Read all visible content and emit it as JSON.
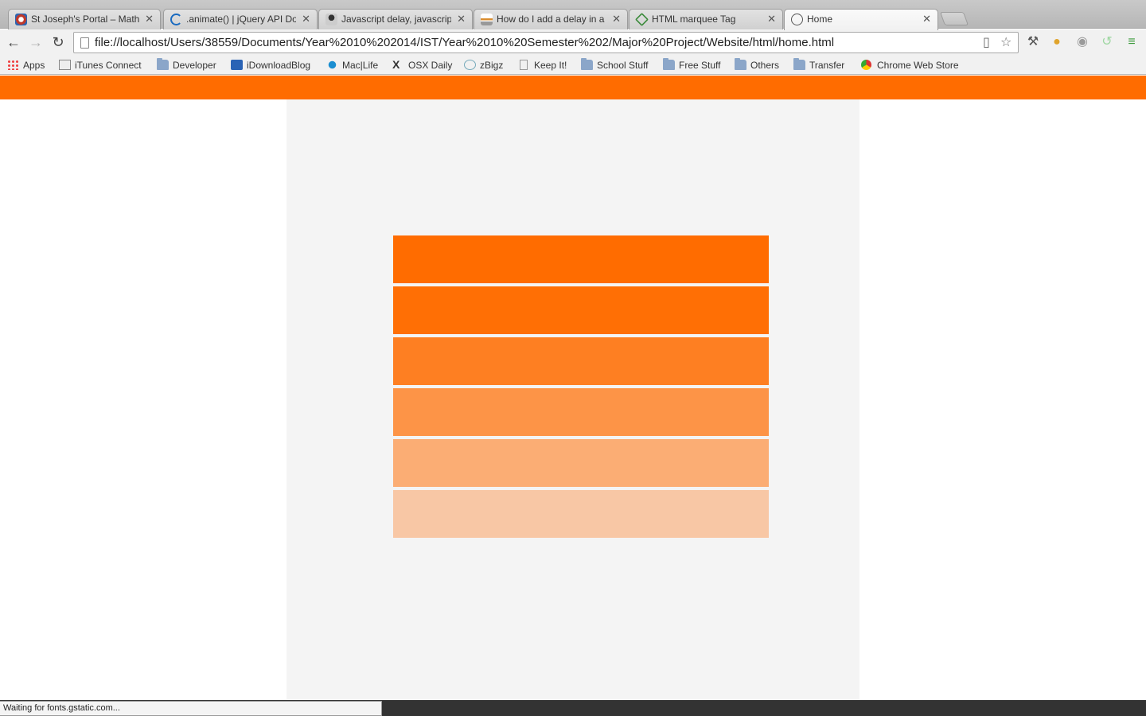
{
  "browser": {
    "tabs": [
      {
        "title": "St Joseph's Portal – Mathem",
        "icon": "portal-icon",
        "color": "#c0392b"
      },
      {
        "title": ".animate() | jQuery API Doc",
        "icon": "jquery-icon",
        "color": "#1a6bc0"
      },
      {
        "title": "Javascript delay, javascript",
        "icon": "avatar-icon",
        "color": "#555555"
      },
      {
        "title": "How do I add a delay in a Ja",
        "icon": "stackoverflow-icon",
        "color": "#d98b2b"
      },
      {
        "title": "HTML marquee Tag",
        "icon": "tutorialspoint-icon",
        "color": "#3a8a3a"
      },
      {
        "title": "Home",
        "icon": "page-loading-icon",
        "color": "#777777"
      }
    ],
    "address": "file://localhost/Users/38559/Documents/Year%2010%202014/IST/Year%2010%20Semester%202/Major%20Project/Website/html/home.html",
    "bookmarks": [
      {
        "label": "Apps",
        "icon": "apps-grid-icon"
      },
      {
        "label": "iTunes Connect",
        "icon": "itunes-connect-icon"
      },
      {
        "label": "Developer",
        "icon": "folder-icon"
      },
      {
        "label": "iDownloadBlog",
        "icon": "idb-icon"
      },
      {
        "label": "Mac|Life",
        "icon": "maclife-icon"
      },
      {
        "label": "OSX Daily",
        "icon": "osx-daily-icon"
      },
      {
        "label": "zBigz",
        "icon": "zbigz-icon"
      },
      {
        "label": "Keep It!",
        "icon": "page-icon"
      },
      {
        "label": "School Stuff",
        "icon": "folder-icon"
      },
      {
        "label": "Free Stuff",
        "icon": "folder-icon"
      },
      {
        "label": "Others",
        "icon": "folder-icon"
      },
      {
        "label": "Transfer",
        "icon": "folder-icon"
      },
      {
        "label": "Chrome Web Store",
        "icon": "chrome-web-store-icon"
      }
    ],
    "status": "Waiting for fonts.gstatic.com..."
  },
  "site": {
    "header_color": "#ff6c00",
    "bar_colors": [
      "#ff6c00",
      "#ff6f05",
      "#fe7f22",
      "#fd9447",
      "#fbad74",
      "#f8c7a5"
    ]
  }
}
